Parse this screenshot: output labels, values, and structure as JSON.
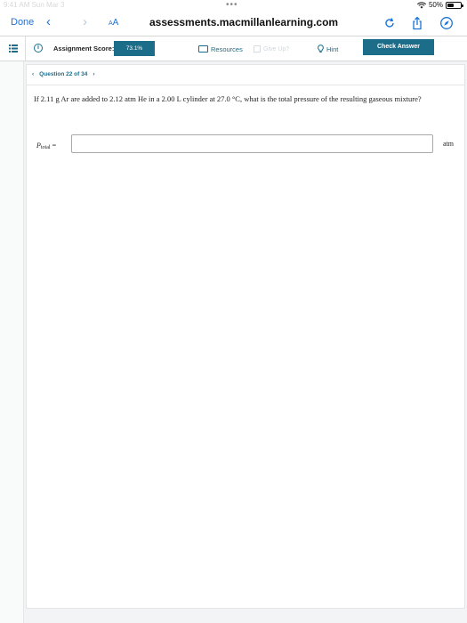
{
  "status_bar": {
    "left_text": "9:41 AM  Sun Mar 3",
    "dots": "•••",
    "battery": "50%",
    "battery_level": 0.5
  },
  "browser": {
    "done_label": "Done",
    "back_glyph": "‹",
    "forward_glyph": "›",
    "text_size_big": "A",
    "text_size_small": "A",
    "url": "assessments.macmillanlearning.com",
    "icons": [
      "reload-icon",
      "share-icon",
      "compass-icon"
    ],
    "accent_color": "#1a73d9"
  },
  "assignment": {
    "score_label": "Assignment Score:",
    "score_value": "73.1%",
    "resources_label": "Resources",
    "give_up_label": "Give Up?",
    "hint_label": "Hint",
    "check_answer_label": "Check Answer",
    "brand_color": "#1b6d8a"
  },
  "question": {
    "nav_prev": "‹",
    "nav_label": "Question 22 of 34",
    "nav_next": "›",
    "prompt": "If 2.11 g Ar are added to 2.12 atm He in a 2.00 L cylinder at 27.0 °C, what is the total pressure of the resulting gaseous mixture?",
    "answer_var": "P",
    "answer_sub": "total",
    "answer_eq": "=",
    "answer_value": "",
    "answer_unit": "atm"
  }
}
